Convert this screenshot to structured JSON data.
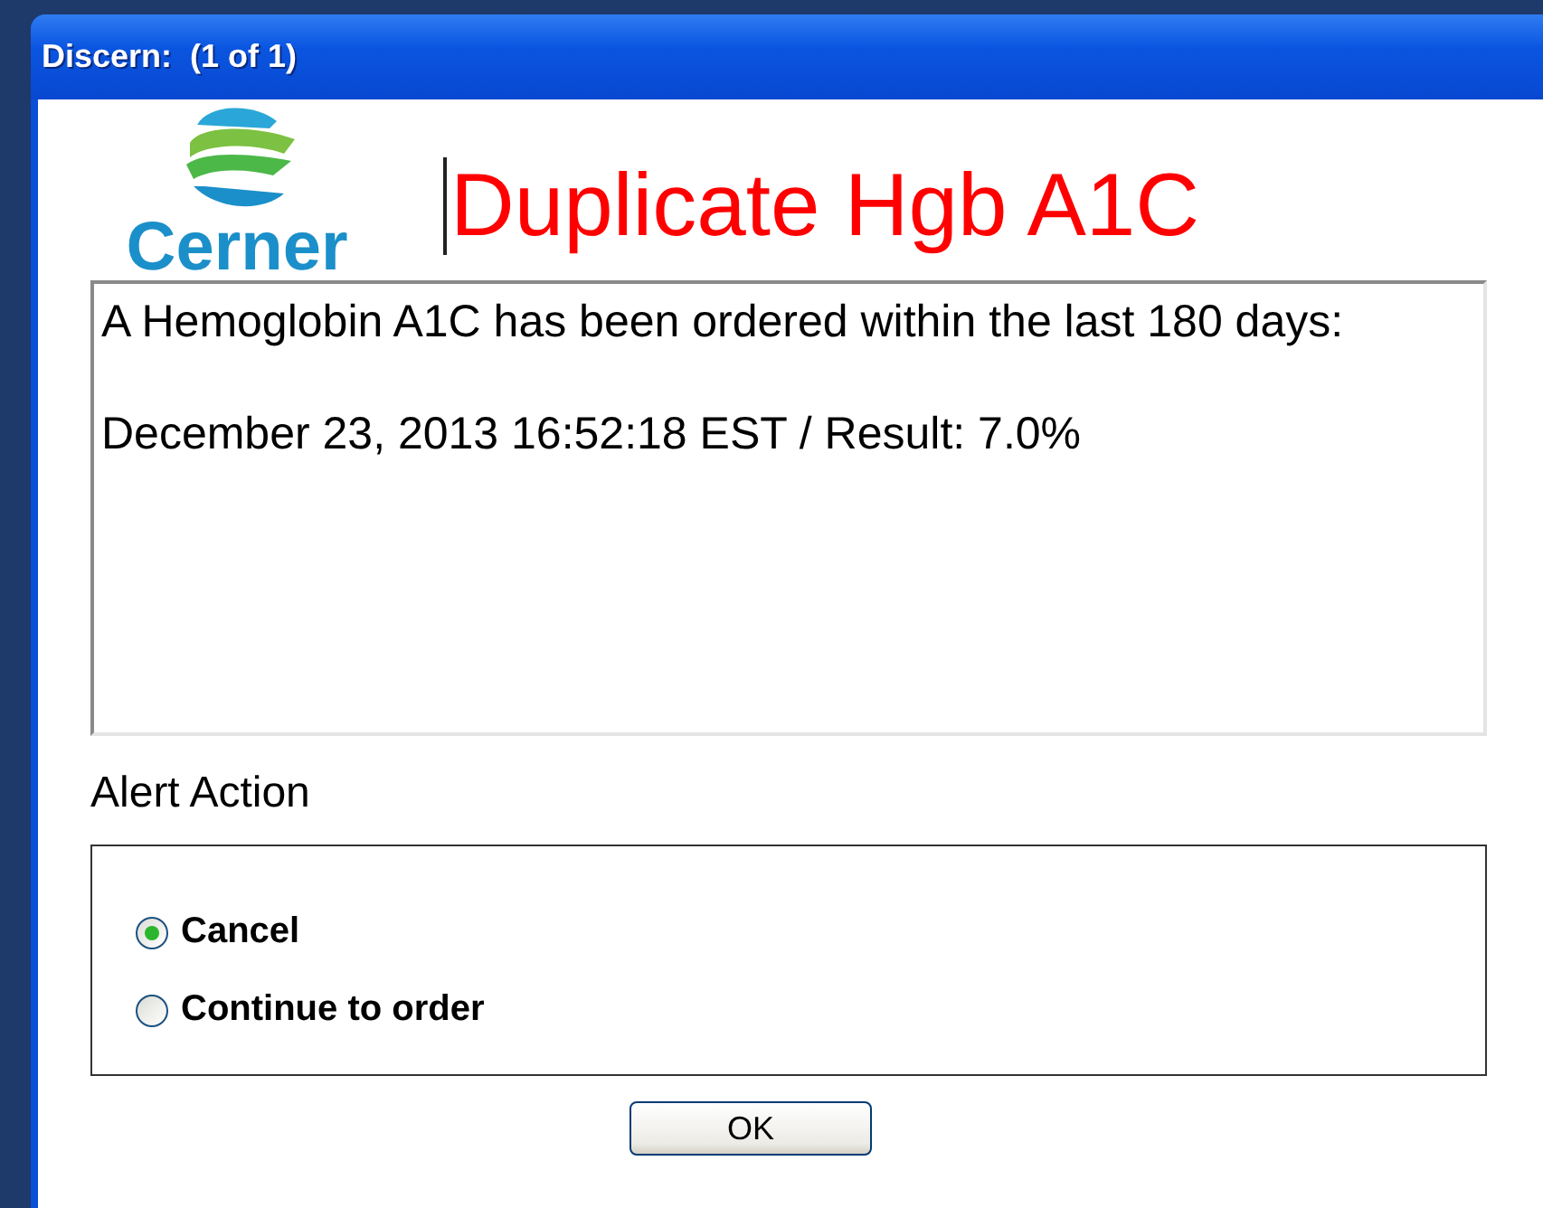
{
  "window": {
    "title": "Discern:  (1 of 1)"
  },
  "logo": {
    "text": "Cerner"
  },
  "heading": "Duplicate Hgb A1C",
  "message": {
    "paragraphs": [
      "A Hemoglobin A1C has been ordered within the last 180 days:",
      "December 23, 2013 16:52:18 EST / Result: 7.0%"
    ]
  },
  "alert_action": {
    "label": "Alert Action",
    "options": [
      {
        "label": "Cancel",
        "selected": true
      },
      {
        "label": "Continue to order",
        "selected": false
      }
    ]
  },
  "buttons": [
    "OK"
  ]
}
